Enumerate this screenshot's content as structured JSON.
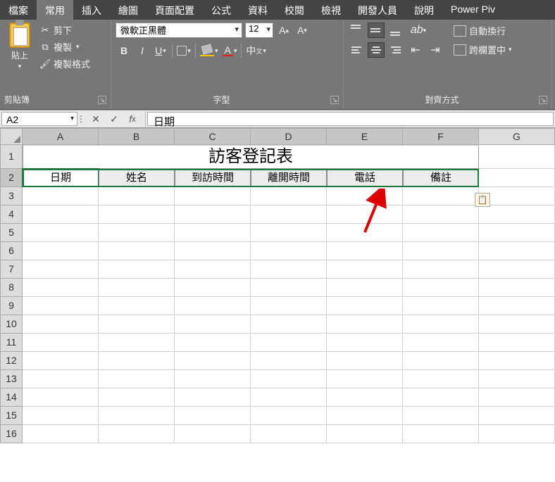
{
  "tabs": [
    "檔案",
    "常用",
    "插入",
    "繪圖",
    "頁面配置",
    "公式",
    "資料",
    "校閱",
    "檢視",
    "開發人員",
    "說明",
    "Power Piv"
  ],
  "active_tab": 1,
  "clipboard": {
    "paste": "貼上",
    "cut": "剪下",
    "copy": "複製",
    "format_painter": "複製格式",
    "group": "剪貼簿"
  },
  "font": {
    "name": "微軟正黑體",
    "size": "12",
    "group": "字型",
    "bold": "B",
    "italic": "I",
    "underline": "U"
  },
  "align": {
    "group": "對齊方式",
    "wrap": "自動換行",
    "merge": "跨欄置中"
  },
  "namebox": "A2",
  "formula": "日期",
  "columns": [
    "A",
    "B",
    "C",
    "D",
    "E",
    "F",
    "G"
  ],
  "title_cell": "訪客登記表",
  "headers": [
    "日期",
    "姓名",
    "到訪時間",
    "離開時間",
    "電話",
    "備註"
  ],
  "row_numbers": [
    "1",
    "2",
    "3",
    "4",
    "5",
    "6",
    "7",
    "8",
    "9",
    "10",
    "11",
    "12",
    "13",
    "14",
    "15",
    "16"
  ]
}
